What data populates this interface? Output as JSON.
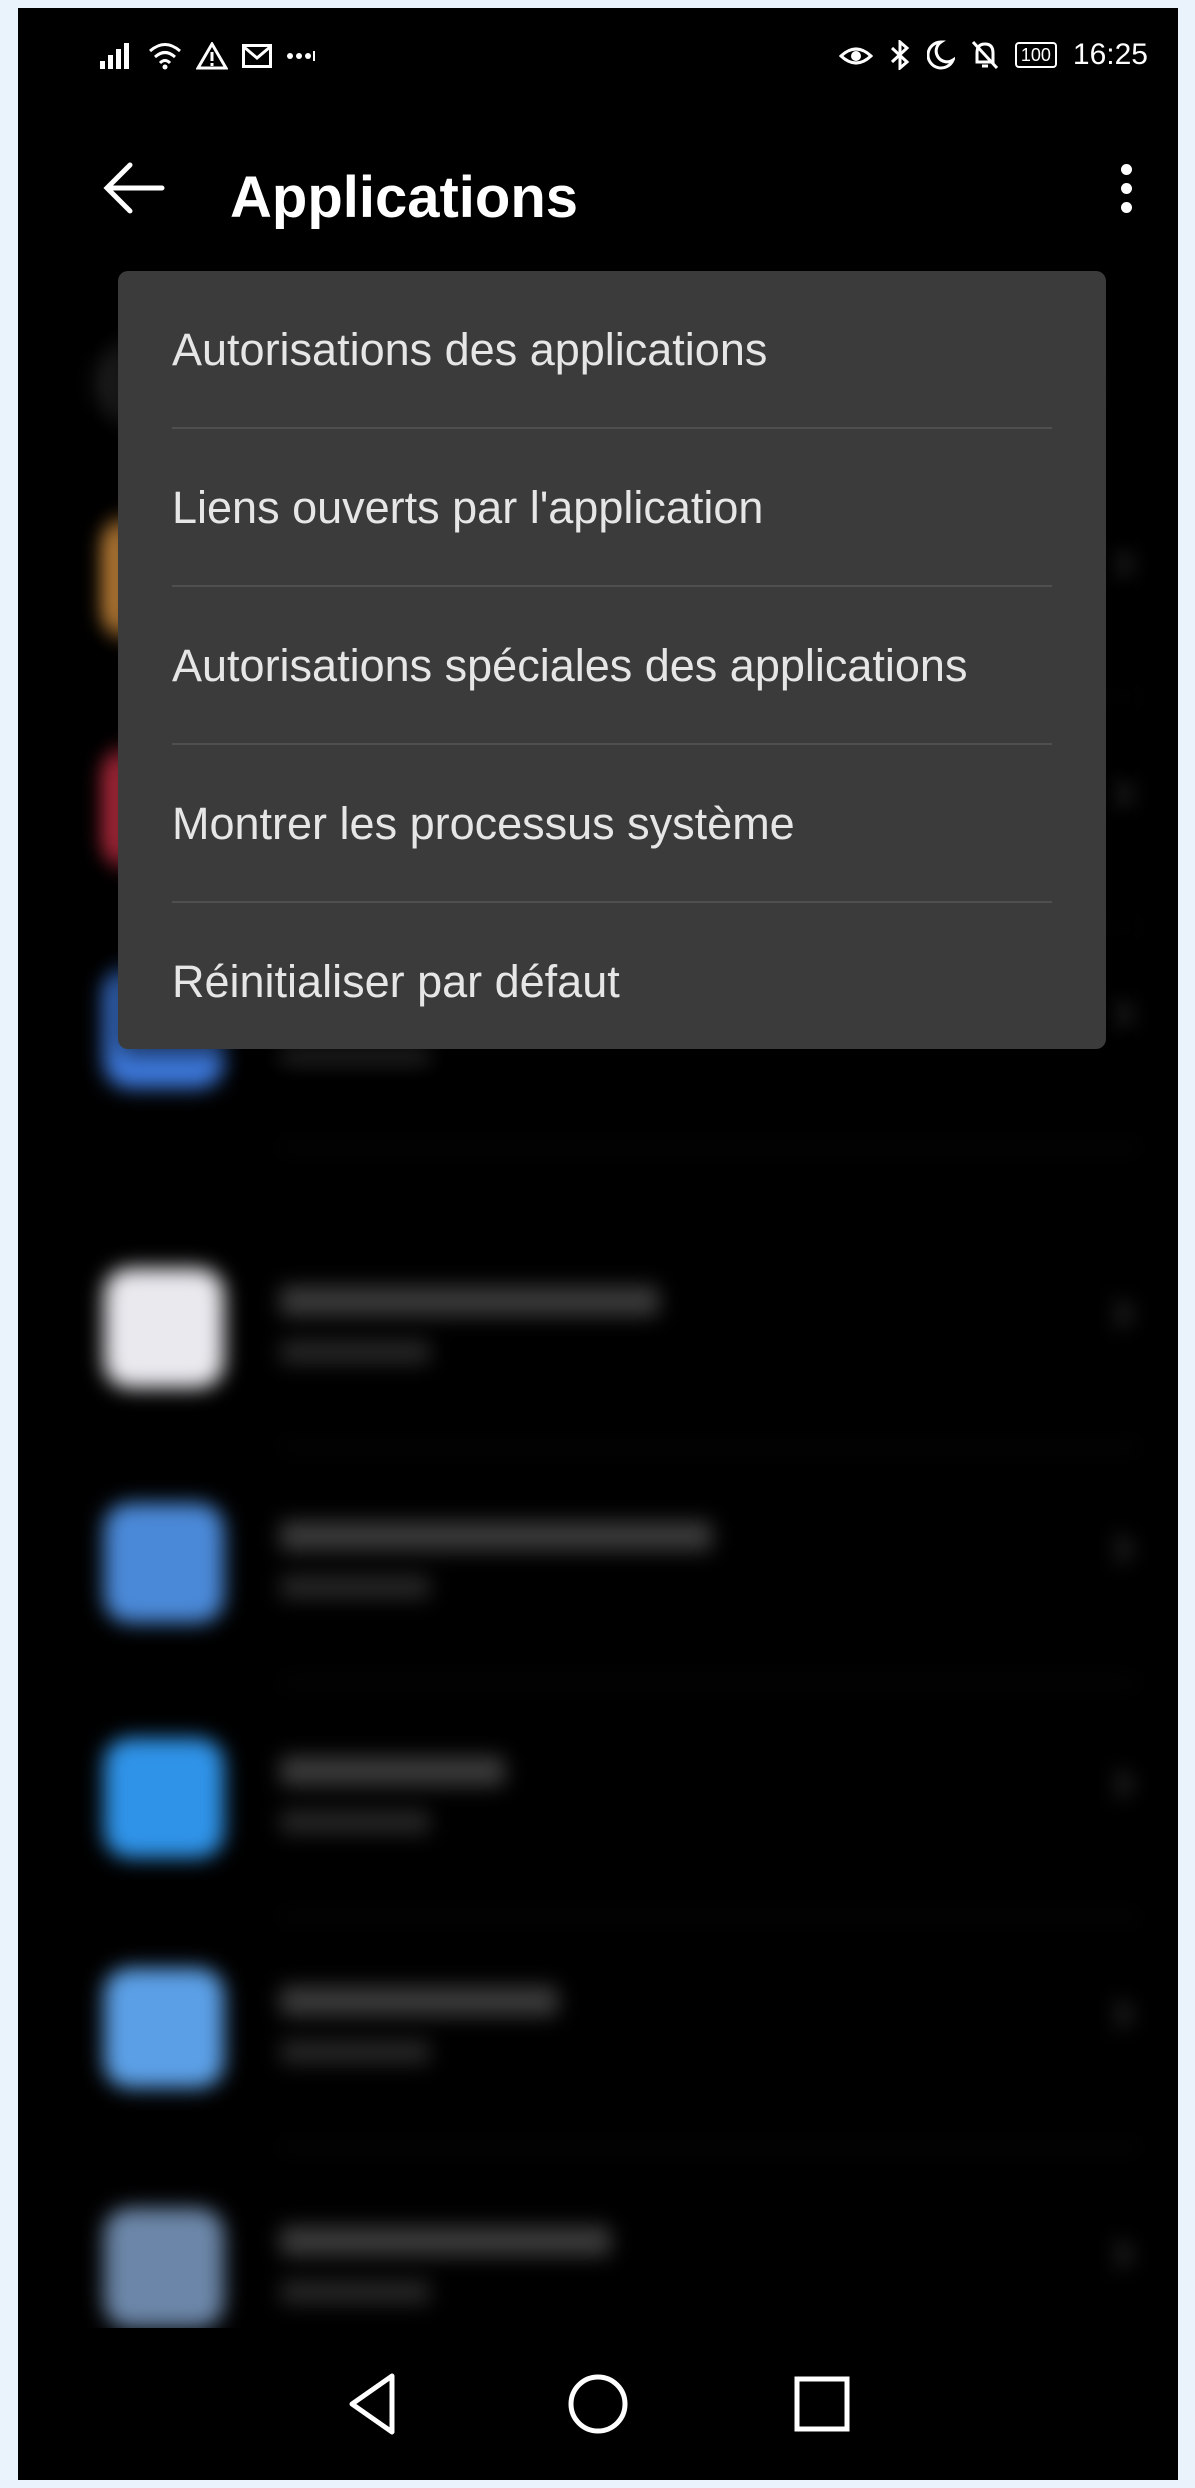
{
  "status_bar": {
    "time": "16:25",
    "battery": "100",
    "left_icons": [
      "signal-icon",
      "wifi-icon",
      "warning-icon",
      "mail-icon",
      "dots-icon"
    ],
    "right_icons": [
      "eye-icon",
      "bluetooth-icon",
      "moon-icon",
      "bell-off-icon",
      "battery-icon"
    ]
  },
  "header": {
    "title": "Applications"
  },
  "menu": {
    "items": [
      {
        "label": "Autorisations des applications"
      },
      {
        "label": "Liens ouverts par l'application"
      },
      {
        "label": "Autorisations spéciales des applications"
      },
      {
        "label": "Montrer les processus système"
      },
      {
        "label": "Réinitialiser par défaut"
      }
    ]
  },
  "apps": [
    {
      "icon_color": "#f0a246"
    },
    {
      "icon_color": "#d8334a"
    },
    {
      "icon_color": "#3e7be0"
    },
    {
      "icon_color": "#e9e9ee"
    },
    {
      "icon_color": "#4a89d8"
    },
    {
      "icon_color": "#2f93e8"
    },
    {
      "icon_color": "#5b9fe6"
    },
    {
      "icon_color": "#6b86a8"
    }
  ],
  "colors": {
    "menu_bg": "#3b3b3b",
    "screen_bg": "#000000",
    "outer_bg": "#eaf3fb"
  }
}
